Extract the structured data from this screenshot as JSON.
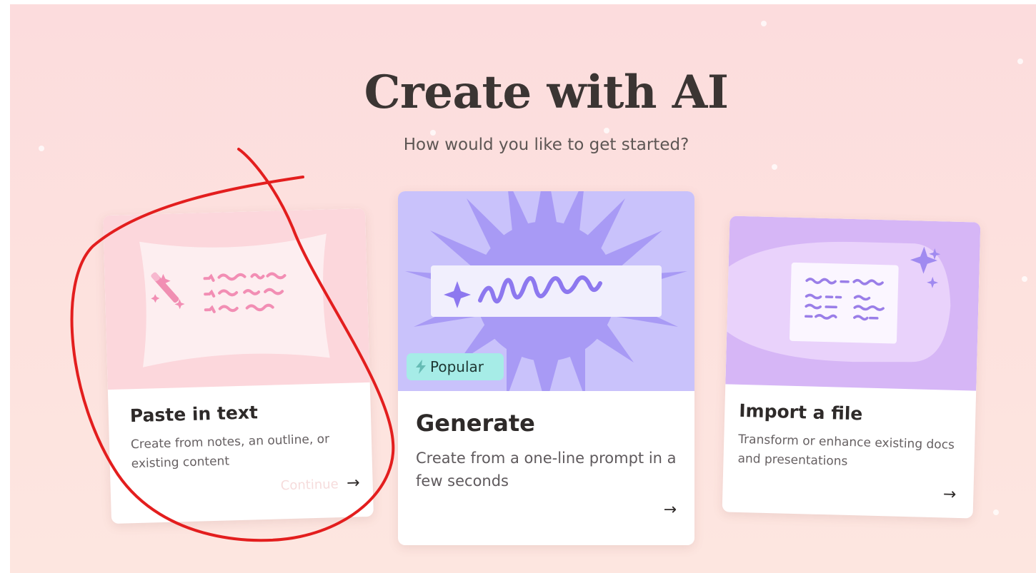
{
  "header": {
    "title": "Create with AI",
    "subtitle": "How would you like to get started?"
  },
  "cards": [
    {
      "title": "Paste in text",
      "description": "Create from notes, an outline, or existing content",
      "action_label": "Continue",
      "arrow": "→",
      "accent_color": "#fcd7dc"
    },
    {
      "title": "Generate",
      "description": "Create from a one-line prompt in a few seconds",
      "badge": "Popular",
      "arrow": "→",
      "accent_color": "#c9c2fb"
    },
    {
      "title": "Import a file",
      "description": "Transform or enhance existing docs and presentations",
      "arrow": "→",
      "accent_color": "#d6b6f6"
    }
  ],
  "annotation": {
    "color": "#e31e1e"
  }
}
